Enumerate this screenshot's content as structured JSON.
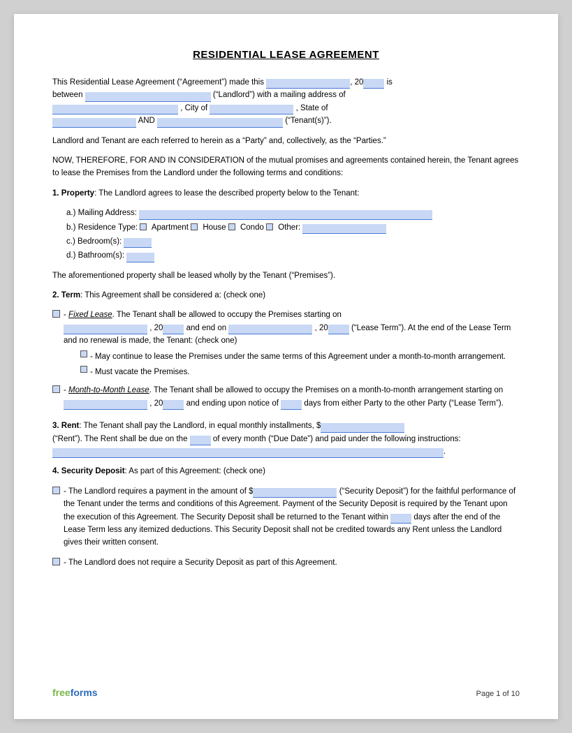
{
  "title": "RESIDENTIAL LEASE AGREEMENT",
  "intro": {
    "line1_start": "This Residential Lease Agreement (“Agreement”) made this",
    "line1_year": "20",
    "line1_end": "is",
    "line2_start": "between",
    "line2_landlord_label": "(“Landlord”) with a mailing address of",
    "line3_city_label": ", City of",
    "line3_state_label": ", State of",
    "line4_and": "AND",
    "line4_tenant_label": "(“Tenant(s)”)."
  },
  "parties_text": "Landlord and Tenant are each referred to herein as a “Party” and, collectively, as the “Parties.”",
  "consideration_text": "NOW, THEREFORE, FOR AND IN CONSIDERATION of the mutual promises and agreements contained herein, the Tenant agrees to lease the Premises from the Landlord under the following terms and conditions:",
  "section1": {
    "label": "1. Property",
    "text": ": The Landlord agrees to lease the described property below to the Tenant:",
    "items": {
      "a_label": "a.)  Mailing Address:",
      "b_label": "b.)  Residence Type:",
      "b_apartment": "Apartment",
      "b_house": "House",
      "b_condo": "Condo",
      "b_other_label": "Other:",
      "c_label": "c.)  Bedroom(s):",
      "d_label": "d.)  Bathroom(s):"
    },
    "premises_text": "The aforementioned property shall be leased wholly by the Tenant (“Premises”)."
  },
  "section2": {
    "label": "2. Term",
    "text": ": This Agreement shall be considered a: (check one)",
    "fixed_dash": "-",
    "fixed_label": "Fixed Lease",
    "fixed_text1": ". The Tenant shall be allowed to occupy the Premises starting on",
    "fixed_text2": ", 20",
    "fixed_text3": "and end on",
    "fixed_text4": ", 20",
    "fixed_text5": "(“Lease Term”). At the end of the Lease Term and no renewal is made, the Tenant: (check one)",
    "suboption1": "- May continue to lease the Premises under the same terms of this Agreement under a month-to-month arrangement.",
    "suboption2": "- Must vacate the Premises.",
    "month_dash": "-",
    "month_label": "Month-to-Month Lease",
    "month_text1": ". The Tenant shall be allowed to occupy the Premises on a month-to-month arrangement starting on",
    "month_text2": ", 20",
    "month_text3": "and ending upon notice of",
    "month_text4": "days from either Party to the other Party (“Lease Term”)."
  },
  "section3": {
    "label": "3. Rent",
    "text1": ": The Tenant shall pay the Landlord, in equal monthly installments, $",
    "text2": "(“Rent”). The Rent shall be due on the",
    "text3": "of every month (“Due Date”) and paid under the following instructions:"
  },
  "section4": {
    "label": "4. Security Deposit",
    "text": ": As part of this Agreement: (check one)",
    "option1_text1": "- The Landlord requires a payment in the amount of $",
    "option1_text2": "(“Security Deposit”) for the faithful performance of the Tenant under the terms and conditions of this Agreement. Payment of the Security Deposit is required by the Tenant upon the execution of this Agreement. The Security Deposit shall be returned to the Tenant within",
    "option1_text3": "days after the end of the Lease Term less any itemized deductions. This Security Deposit shall not be credited towards any Rent unless the Landlord gives their written consent.",
    "option2_text": "- The Landlord does not require a Security Deposit as part of this Agreement."
  },
  "footer": {
    "brand_free": "free",
    "brand_forms": "forms",
    "page": "Page 1 of 10"
  }
}
